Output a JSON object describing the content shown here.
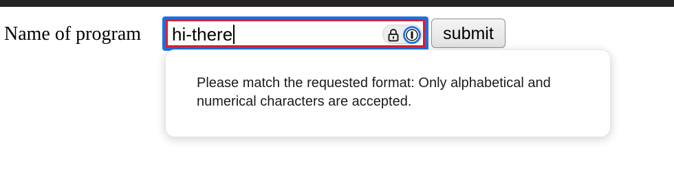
{
  "form": {
    "label": "Name of program",
    "input_value": "hi-there",
    "submit_label": "submit"
  },
  "password_manager": {
    "lock_icon": "lock-icon",
    "logo_icon": "password-manager-logo-icon"
  },
  "validation": {
    "message": "Please match the requested format: Only alphabetical and numerical characters are accepted."
  },
  "colors": {
    "focus_ring": "#1f6fe0",
    "invalid_border": "#d71f34",
    "window_bar": "#252525"
  }
}
